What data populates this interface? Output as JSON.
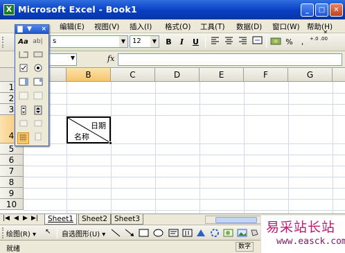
{
  "window": {
    "app_icon": "X",
    "title": "Microsoft Excel - Book1",
    "minimize_icon": "minimize-icon",
    "maximize_icon": "maximize-icon",
    "close_icon": "close-icon"
  },
  "menu": {
    "items": [
      {
        "label": "编辑(E)"
      },
      {
        "label": "视图(V)"
      },
      {
        "label": "插入(I)"
      },
      {
        "label": "格式(O)"
      },
      {
        "label": "工具(T)"
      },
      {
        "label": "数据(D)"
      },
      {
        "label": "窗口(W)"
      },
      {
        "label": "帮助(H)"
      }
    ],
    "doc_close": "× "
  },
  "format_toolbar": {
    "font_suffix": "s",
    "font_size": "12",
    "bold": "B",
    "italic": "I",
    "underline": "U",
    "percent": "%",
    "comma": ",",
    "increase_decimal": "+.0 .00"
  },
  "formula_bar": {
    "name_box": "",
    "fx_label": "fx",
    "formula": ""
  },
  "sheet": {
    "columns": [
      "B",
      "C",
      "D",
      "E",
      "F",
      "G"
    ],
    "rows": [
      "1",
      "2",
      "3",
      "4",
      "5",
      "6",
      "7",
      "8",
      "9",
      "10"
    ],
    "selected_column": "B",
    "selected_row": "4",
    "cell_b4": {
      "top_right": "日期",
      "bottom_left": "名称"
    }
  },
  "tabs": {
    "sheets": [
      "Sheet1",
      "Sheet2",
      "Sheet3"
    ],
    "active": "Sheet1"
  },
  "drawing_toolbar": {
    "draw_label": "绘图(R)",
    "autoshapes_label": "自选图形(U)"
  },
  "status": {
    "ready": "就绪",
    "num_indicator": "数字"
  },
  "forms_toolbar": {
    "label_icon": "Aa",
    "edit_icon": "ab|"
  },
  "watermark": {
    "top": "易采站长站",
    "bottom": "www.easck.com"
  }
}
